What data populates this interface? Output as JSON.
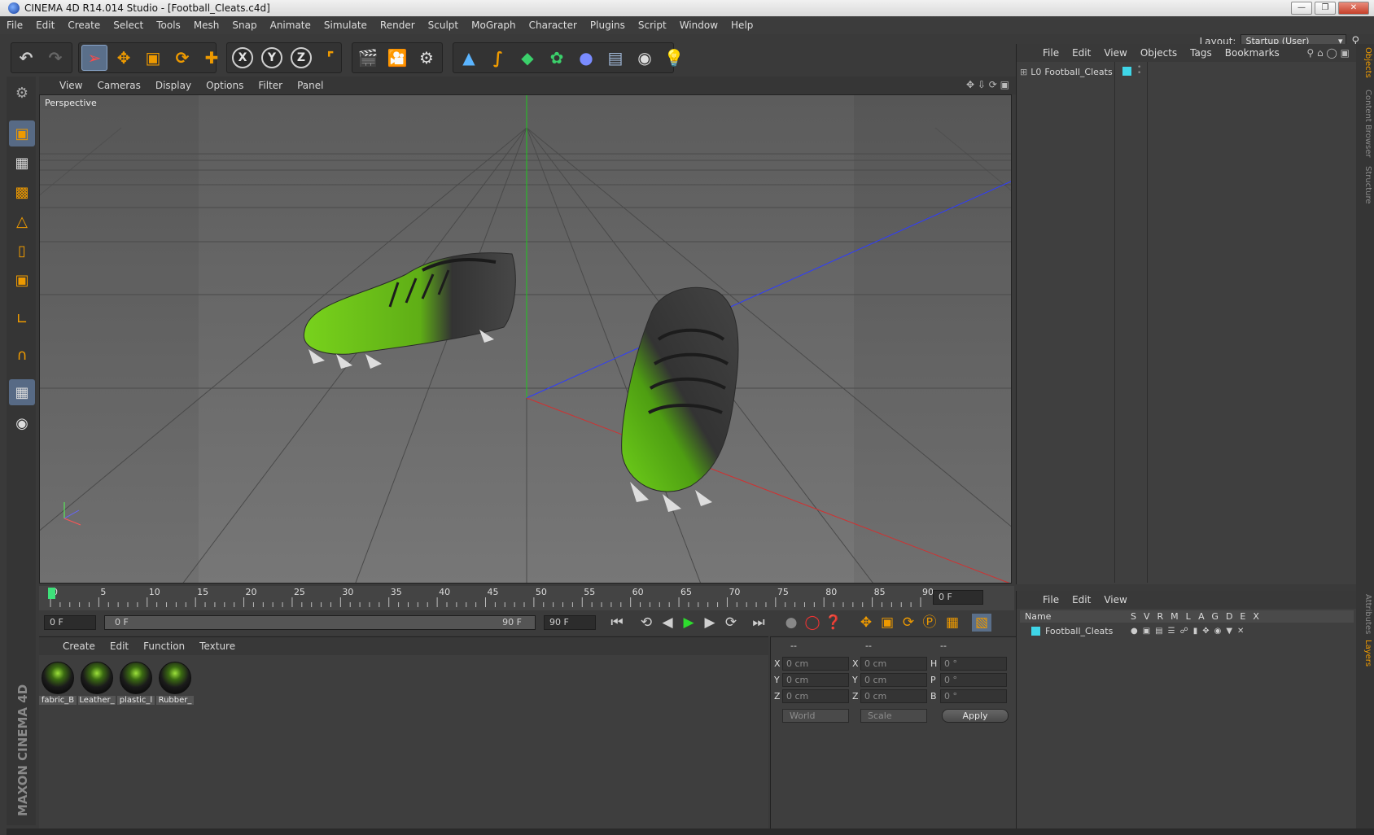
{
  "window": {
    "title": "CINEMA 4D R14.014 Studio - [Football_Cleats.c4d]"
  },
  "menu": [
    "File",
    "Edit",
    "Create",
    "Select",
    "Tools",
    "Mesh",
    "Snap",
    "Animate",
    "Simulate",
    "Render",
    "Sculpt",
    "MoGraph",
    "Character",
    "Plugins",
    "Script",
    "Window",
    "Help"
  ],
  "layout": {
    "label": "Layout:",
    "value": "Startup (User)"
  },
  "viewport": {
    "menu": [
      "View",
      "Cameras",
      "Display",
      "Options",
      "Filter",
      "Panel"
    ],
    "label": "Perspective"
  },
  "timeline": {
    "ticks": [
      "0",
      "5",
      "10",
      "15",
      "20",
      "25",
      "30",
      "35",
      "40",
      "45",
      "50",
      "55",
      "60",
      "65",
      "70",
      "75",
      "80",
      "85",
      "90"
    ],
    "frame": "0 F"
  },
  "anim": {
    "start": "0 F",
    "range_start": "0 F",
    "range_end": "90 F",
    "end": "90 F"
  },
  "materials": {
    "menu": [
      "Create",
      "Edit",
      "Function",
      "Texture"
    ],
    "items": [
      "fabric_B",
      "Leather_",
      "plastic_l",
      "Rubber_"
    ]
  },
  "coords": {
    "header": [
      "--",
      "--",
      "--"
    ],
    "rows": [
      {
        "a": "X",
        "av": "0 cm",
        "b": "X",
        "bv": "0 cm",
        "c": "H",
        "cv": "0 °"
      },
      {
        "a": "Y",
        "av": "0 cm",
        "b": "Y",
        "bv": "0 cm",
        "c": "P",
        "cv": "0 °"
      },
      {
        "a": "Z",
        "av": "0 cm",
        "b": "Z",
        "bv": "0 cm",
        "c": "B",
        "cv": "0 °"
      }
    ],
    "mode1": "World",
    "mode2": "Scale",
    "apply": "Apply"
  },
  "objects": {
    "menu": [
      "File",
      "Edit",
      "View",
      "Objects",
      "Tags",
      "Bookmarks"
    ],
    "items": [
      {
        "name": "Football_Cleats"
      }
    ]
  },
  "layers": {
    "menu": [
      "File",
      "Edit",
      "View"
    ],
    "header": {
      "name": "Name",
      "cols": [
        "S",
        "V",
        "R",
        "M",
        "L",
        "A",
        "G",
        "D",
        "E",
        "X"
      ]
    },
    "items": [
      {
        "name": "Football_Cleats"
      }
    ]
  },
  "side_tabs": [
    "Objects",
    "Content Browser",
    "Structure",
    "Attributes",
    "Layers"
  ],
  "logo": {
    "line1": "MAXON",
    "line2": "CINEMA 4D"
  },
  "colors": {
    "accent": "#ee9a00",
    "shoe_green": "#6ec21a",
    "layer_cyan": "#3fd6e8"
  }
}
